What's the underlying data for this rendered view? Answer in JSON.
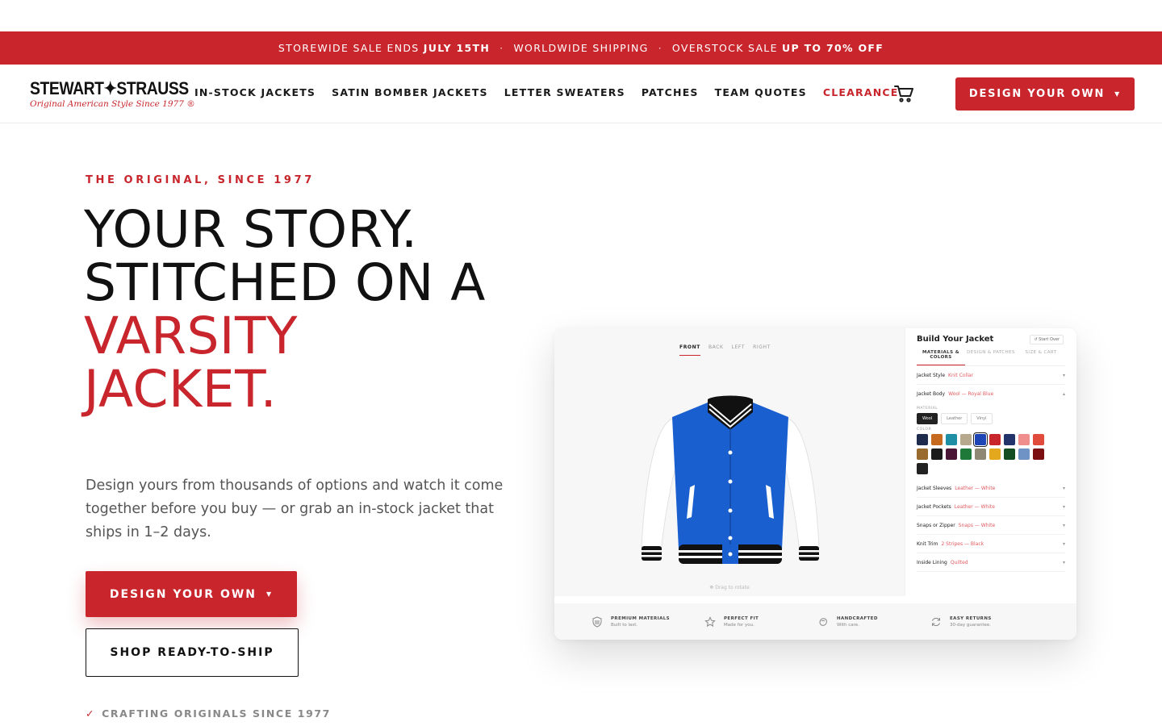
{
  "promo": {
    "part1_prefix": "STOREWIDE SALE ENDS",
    "part1_bold": "JULY 15TH",
    "separator": "·",
    "part2": "WORLDWIDE SHIPPING",
    "part3_prefix": "OVERSTOCK SALE",
    "part3_bold": "UP TO 70% OFF"
  },
  "header": {
    "logo_brand": "STEWART✦STRAUSS",
    "logo_tagline": "Original American Style Since 1977 ®",
    "nav": [
      {
        "label": "IN-STOCK JACKETS"
      },
      {
        "label": "SATIN BOMBER JACKETS"
      },
      {
        "label": "LETTER SWEATERS"
      },
      {
        "label": "PATCHES"
      },
      {
        "label": "TEAM QUOTES"
      },
      {
        "label": "CLEARANCE"
      }
    ],
    "cart_icon": "cart-icon",
    "cta_label": "DESIGN YOUR OWN",
    "caret": "▼"
  },
  "hero": {
    "eyebrow": "THE ORIGINAL, SINCE 1977",
    "headline_line1": "YOUR STORY.",
    "headline_line2": "STITCHED ON A",
    "headline_accent1": "VARSITY",
    "headline_accent2": "JACKET.",
    "lede": "Design yours from thousands of options and watch it come together before you buy — or grab an in-stock jacket that ships in 1–2 days.",
    "primary_cta": "DESIGN YOUR OWN",
    "secondary_cta": "SHOP READY-TO-SHIP",
    "trust_check": "✓",
    "trust_text": "CRAFTING ORIGINALS SINCE 1977"
  },
  "builder": {
    "view_tabs": [
      "FRONT",
      "BACK",
      "LEFT",
      "RIGHT"
    ],
    "drag_hint": "✥ Drag to rotate",
    "title": "Build Your Jacket",
    "start_over": "↺ Start Over",
    "panel_tabs": [
      "MATERIALS & COLORS",
      "DESIGN & PATCHES",
      "SIZE & CART"
    ],
    "options": [
      {
        "label": "Jacket Style",
        "value": "Knit Collar",
        "chev": "▾"
      },
      {
        "label": "Jacket Body",
        "value": "Wool — Royal Blue",
        "chev": "▴"
      },
      {
        "label": "Jacket Sleeves",
        "value": "Leather — White",
        "chev": "▾"
      },
      {
        "label": "Jacket Pockets",
        "value": "Leather — White",
        "chev": "▾"
      },
      {
        "label": "Snaps or Zipper",
        "value": "Snaps — White",
        "chev": "▾"
      },
      {
        "label": "Knit Trim",
        "value": "2 Stripes — Black",
        "chev": "▾"
      },
      {
        "label": "Inside Lining",
        "value": "Quilted",
        "chev": "▾"
      }
    ],
    "material_label": "MATERIAL",
    "materials": [
      "Wool",
      "Leather",
      "Vinyl"
    ],
    "color_label": "COLOR",
    "swatches": [
      "#1f2b4d",
      "#c56a1e",
      "#1f8fa6",
      "#b6a98d",
      "#1d45b5",
      "#c8252c",
      "#22346b",
      "#f08e8e",
      "#e14b3c",
      "#9a6b2f",
      "#1b1b1b",
      "#4b1535",
      "#1f7a3a",
      "#8e8874",
      "#e3a81e",
      "#134d22",
      "#6f93c4",
      "#7c0f12",
      "#222222"
    ],
    "features": [
      {
        "icon": "shield-icon",
        "title": "PREMIUM MATERIALS",
        "sub": "Built to last."
      },
      {
        "icon": "star-icon",
        "title": "PERFECT FIT",
        "sub": "Made for you."
      },
      {
        "icon": "hand-icon",
        "title": "HANDCRAFTED",
        "sub": "With care."
      },
      {
        "icon": "refresh-icon",
        "title": "EASY RETURNS",
        "sub": "30-day guarantee."
      }
    ]
  },
  "colors": {
    "accent": "#c8252c",
    "jacket_body": "#1a5fd0",
    "sleeves": "#ffffff"
  }
}
